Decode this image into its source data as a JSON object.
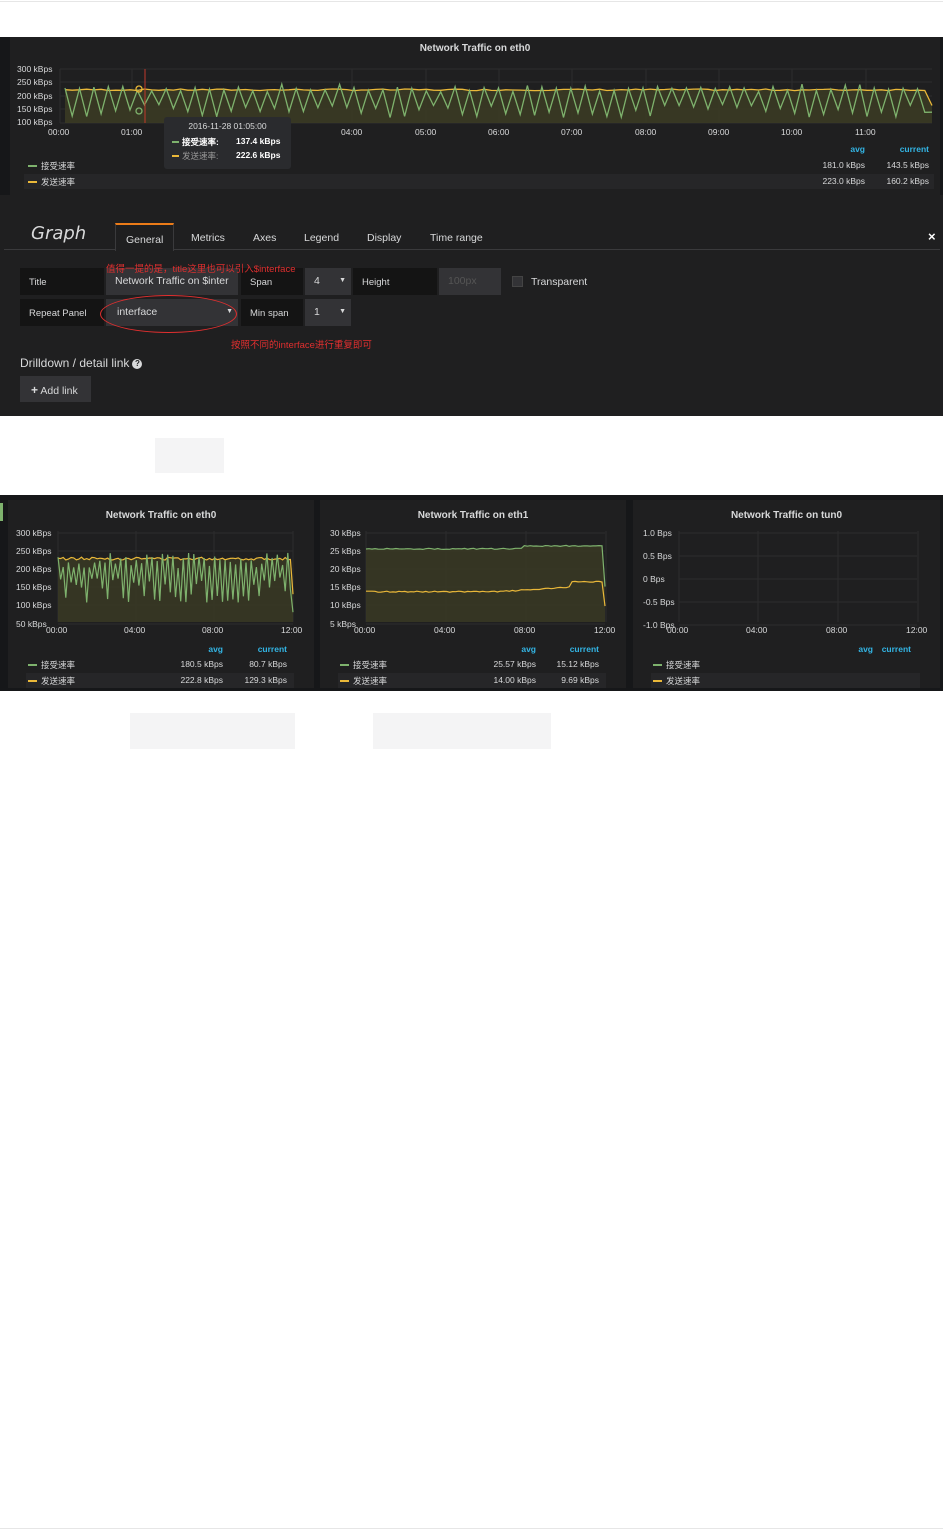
{
  "top_panel": {
    "title": "Network Traffic on eth0",
    "y_ticks": [
      "300 kBps",
      "250 kBps",
      "200 kBps",
      "150 kBps",
      "100 kBps"
    ],
    "x_ticks": [
      "00:00",
      "01:00",
      "04:00",
      "05:00",
      "06:00",
      "07:00",
      "08:00",
      "09:00",
      "10:00",
      "11:00"
    ],
    "legend_headers": {
      "avg": "avg",
      "current": "current"
    },
    "series": [
      {
        "name": "接受速率",
        "avg": "181.0 kBps",
        "current": "143.5 kBps",
        "color": "#7eb26d"
      },
      {
        "name": "发送速率",
        "avg": "223.0 kBps",
        "current": "160.2 kBps",
        "color": "#eab839"
      }
    ],
    "tooltip": {
      "time": "2016-11-28 01:05:00",
      "rows": [
        {
          "name": "接受速率:",
          "value": "137.4 kBps",
          "color": "#7eb26d"
        },
        {
          "name": "发送速率:",
          "value": "222.6 kBps",
          "color": "#eab839"
        }
      ]
    }
  },
  "editor": {
    "title": "Graph",
    "tabs": [
      "General",
      "Metrics",
      "Axes",
      "Legend",
      "Display",
      "Time range"
    ],
    "active_tab": "General",
    "close_icon": "×",
    "fields": {
      "title_label": "Title",
      "title_value": "Network Traffic on $inter",
      "span_label": "Span",
      "span_value": "4",
      "height_label": "Height",
      "height_placeholder": "100px",
      "transparent_label": "Transparent",
      "repeat_label": "Repeat Panel",
      "repeat_value": "interface",
      "minspan_label": "Min span",
      "minspan_value": "1"
    },
    "annotations": {
      "title_note": "值得一提的是，title这里也可以引入$interface",
      "repeat_note": "按照不同的interface进行重复即可"
    },
    "drilldown_title": "Drilldown / detail link",
    "drilldown_help_icon": "?",
    "add_link_label": "Add link",
    "add_link_icon": "+"
  },
  "bottom_panels": [
    {
      "title": "Network Traffic on eth0",
      "y_ticks": [
        "300 kBps",
        "250 kBps",
        "200 kBps",
        "150 kBps",
        "100 kBps",
        "50 kBps"
      ],
      "x_ticks": [
        "00:00",
        "04:00",
        "08:00",
        "12:00"
      ],
      "legend_headers": {
        "avg": "avg",
        "current": "current"
      },
      "series": [
        {
          "name": "接受速率",
          "avg": "180.5 kBps",
          "current": "80.7 kBps"
        },
        {
          "name": "发送速率",
          "avg": "222.8 kBps",
          "current": "129.3 kBps"
        }
      ]
    },
    {
      "title": "Network Traffic on eth1",
      "y_ticks": [
        "30 kBps",
        "25 kBps",
        "20 kBps",
        "15 kBps",
        "10 kBps",
        "5 kBps"
      ],
      "x_ticks": [
        "00:00",
        "04:00",
        "08:00",
        "12:00"
      ],
      "legend_headers": {
        "avg": "avg",
        "current": "current"
      },
      "series": [
        {
          "name": "接受速率",
          "avg": "25.57 kBps",
          "current": "15.12 kBps"
        },
        {
          "name": "发送速率",
          "avg": "14.00 kBps",
          "current": "9.69 kBps"
        }
      ]
    },
    {
      "title": "Network Traffic on tun0",
      "y_ticks": [
        "1.0 Bps",
        "0.5 Bps",
        "0 Bps",
        "-0.5 Bps",
        "-1.0 Bps"
      ],
      "x_ticks": [
        "00:00",
        "04:00",
        "08:00",
        "12:00"
      ],
      "legend_headers": {
        "avg": "avg",
        "current": "current"
      },
      "series": [
        {
          "name": "接受速率",
          "avg": "",
          "current": ""
        },
        {
          "name": "发送速率",
          "avg": "",
          "current": ""
        }
      ]
    }
  ],
  "colors": {
    "rx": "#7eb26d",
    "tx": "#eab839",
    "accent": "#eb7b18",
    "legend_head": "#33b5e5",
    "annotation": "#e02f2f"
  }
}
